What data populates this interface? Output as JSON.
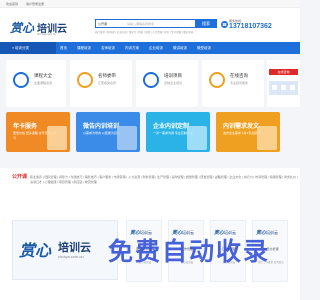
{
  "topbar": {
    "left": "欢迎来到",
    "right": "用户登录注册"
  },
  "header": {
    "logo_text": "赏心",
    "logo_cn": "培训云",
    "logo_url": "chuiya.com.cn",
    "search": {
      "category": "公开课",
      "placeholder": "请输入课程名称搜索",
      "button": "搜索"
    },
    "hotwords": "热门推荐 | 新开课 | 企业内训 | 领导力 | 销售 | 营销 | 人力资源 | 财务 | 生产管理 | 职业素养",
    "phone_label": "服务热线",
    "phone": "13718107362"
  },
  "nav": {
    "category": "培训分类",
    "items": [
      "首页",
      "课程培训",
      "名师培训",
      "内训方案",
      "企业培训",
      "微讲培训",
      "微型培训"
    ]
  },
  "cards": [
    {
      "title": "课程大全",
      "sub": "全面课程资源",
      "color": "#1e6fd9"
    },
    {
      "title": "名师委带",
      "sub": "汇聚各类名师",
      "color": "#f0a020"
    },
    {
      "title": "培训项目",
      "sub": "定制企业培训",
      "color": "#1e6fd9"
    },
    {
      "title": "在线咨询",
      "sub": "专业顾问服务",
      "color": "#f0a020"
    }
  ],
  "banner": {
    "badge": "在线咨询"
  },
  "features": [
    {
      "title": "年卡服务",
      "sub": "更低价格 更多课程 全年无限次学习",
      "color": "#f08a24"
    },
    {
      "title": "微告内训培训",
      "sub": "以需求为导向 以结果为目标",
      "color": "#3b8ce8"
    },
    {
      "title": "企业内训定制",
      "sub": "一对一需求沟通 专业定制方案",
      "color": "#2bb3e8"
    },
    {
      "title": "内训需求发文",
      "sub": "发布企业需求 1对1专业顾问",
      "color": "#f0a020"
    }
  ],
  "panel": {
    "title": "公开课",
    "keywords": "职业素养 | 团队管理 | 领导力 | 沟通技巧 | 销售技巧 | 客户服务 | 市场营销 | 人力资源 | 财务管理 | 生产管理 | 采购管理 | 质量管理 | 研发管理 | 战略管理 | 企业文化 | 执行力 | 时间管理 | 情绪管理 | 商务礼仪 | 演讲口才 | 心理健康 | 项目管理 | 供应链 | 物流管理",
    "big_logo": {
      "mark": "赏心",
      "cn": "培训云",
      "url": "chuiya.com.cn"
    },
    "tiles": [
      {
        "logo_mark": "赏心",
        "logo_cn": "培训云",
        "name": "营业培训课程",
        "sub": "赏心培训云"
      },
      {
        "logo_mark": "赏心",
        "logo_cn": "培训云",
        "name": "《工作管理》",
        "sub": "赏心培训云"
      },
      {
        "logo_mark": "赏心",
        "logo_cn": "培训云",
        "name": "《工作管理》",
        "sub": "赏心培训云"
      },
      {
        "logo_mark": "赏心",
        "logo_cn": "培训云",
        "name": "人员分析课",
        "sub": "部门工作要求 实务要点"
      }
    ]
  },
  "watermark": "免费自动收录"
}
